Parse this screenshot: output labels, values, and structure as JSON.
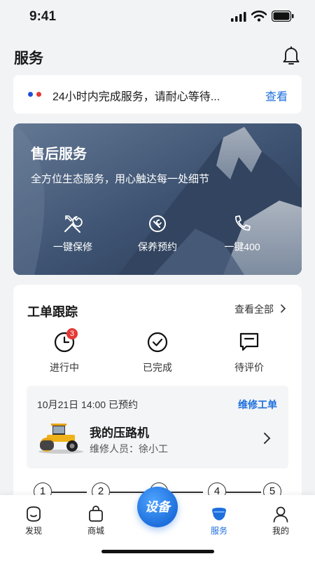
{
  "status_bar": {
    "time": "9:41"
  },
  "header": {
    "title": "服务"
  },
  "notice": {
    "text": "24小时内完成服务，请耐心等待...",
    "link": "查看",
    "dot_colors": [
      "#1e4fd6",
      "#e53935"
    ]
  },
  "banner": {
    "title": "售后服务",
    "subtitle": "全方位生态服务，用心触达每一处细节",
    "actions": [
      {
        "label": "一键保修",
        "icon": "tools-icon"
      },
      {
        "label": "保养预约",
        "icon": "maintenance-icon"
      },
      {
        "label": "一键400",
        "icon": "phone-icon"
      }
    ]
  },
  "work_orders": {
    "title": "工单跟踪",
    "view_all": "查看全部",
    "statuses": [
      {
        "label": "进行中",
        "icon": "clock-icon",
        "badge": "3"
      },
      {
        "label": "已完成",
        "icon": "check-circle-icon"
      },
      {
        "label": "待评价",
        "icon": "comment-icon"
      }
    ],
    "order": {
      "date": "10月21日 14:00 已预约",
      "type": "维修工单",
      "machine_name": "我的压路机",
      "staff": "维修人员：徐小工"
    },
    "steps": [
      "1",
      "2",
      "3",
      "4",
      "5"
    ]
  },
  "tabbar": {
    "items": [
      {
        "label": "发现",
        "icon": "discover-icon"
      },
      {
        "label": "商城",
        "icon": "bag-icon"
      },
      {
        "label": "服务",
        "icon": "service-icon",
        "active": true
      },
      {
        "label": "我的",
        "icon": "user-icon"
      }
    ],
    "center_label": "设备",
    "accent": "#1e6fdc"
  }
}
